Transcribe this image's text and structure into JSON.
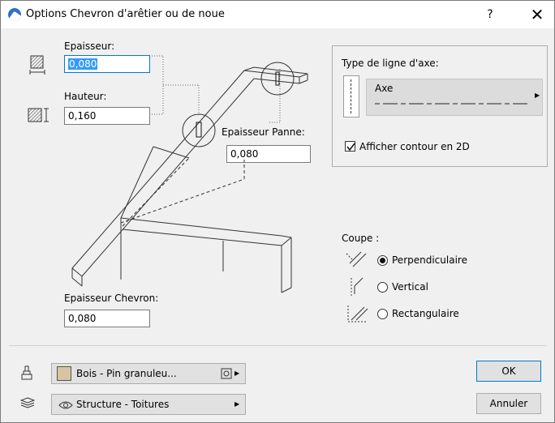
{
  "window": {
    "title": "Options Chevron d'arêtier ou de noue",
    "help_label": "?",
    "close_label": "✕"
  },
  "fields": {
    "epaisseur": {
      "label": "Epaisseur:",
      "value": "0,080"
    },
    "hauteur": {
      "label": "Hauteur:",
      "value": "0,160"
    },
    "epaisseur_panne": {
      "label": "Epaisseur Panne:",
      "value": "0,080"
    },
    "epaisseur_chevron": {
      "label": "Epaisseur Chevron:",
      "value": "0,080"
    }
  },
  "axis_line": {
    "section_label": "Type de ligne d'axe:",
    "selected_type": "Axe",
    "show_contour_label": "Afficher contour en 2D",
    "show_contour_checked": true
  },
  "coupe": {
    "label": "Coupe :",
    "options": [
      {
        "label": "Perpendiculaire",
        "selected": true
      },
      {
        "label": "Vertical",
        "selected": false
      },
      {
        "label": "Rectangulaire",
        "selected": false
      }
    ]
  },
  "bottom": {
    "material": "Bois - Pin granuleu...",
    "material_color": "#d8c4a4",
    "layer": "Structure - Toitures",
    "ok_label": "OK",
    "cancel_label": "Annuler"
  }
}
